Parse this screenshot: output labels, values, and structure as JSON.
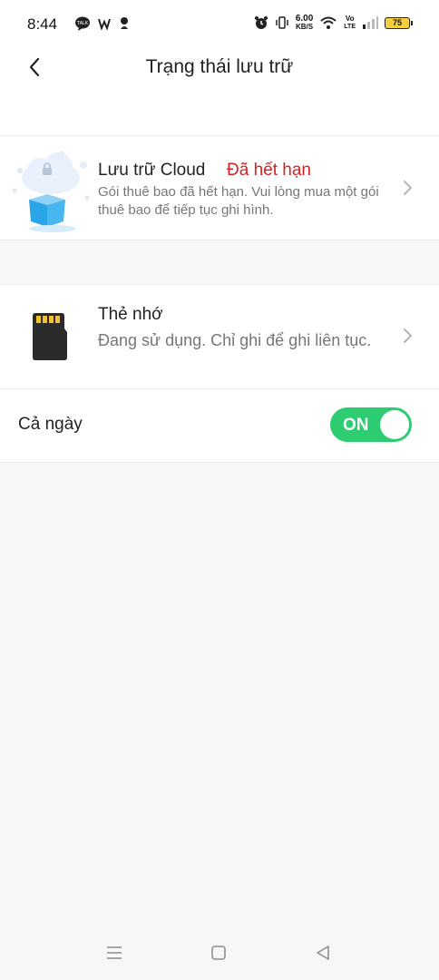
{
  "status_bar": {
    "time": "8:44",
    "app_icons": [
      "talk-icon",
      "w-icon",
      "pin-icon"
    ],
    "net_speed_value": "6.00",
    "net_speed_unit": "KB/S",
    "volte_top": "Vo",
    "volte_bottom": "LTE",
    "battery": "75"
  },
  "header": {
    "title": "Trạng thái lưu trữ",
    "back_icon": "chevron-left-icon"
  },
  "cloud_storage": {
    "title": "Lưu trữ Cloud",
    "badge": "Đã hết hạn",
    "description": "Gói thuê bao đã hết hạn. Vui lòng mua một gói thuê bao để tiếp tục ghi hình.",
    "icon": "cloud-storage-icon"
  },
  "memory_card": {
    "title": "Thẻ nhớ",
    "description": "Đang sử dụng. Chỉ ghi để ghi liên tục.",
    "icon": "sd-card-icon"
  },
  "all_day": {
    "label": "Cả ngày",
    "toggle_text": "ON",
    "toggle_on": true
  },
  "colors": {
    "badge_red": "#d42222",
    "toggle_green": "#2ecc71"
  },
  "nav_bar": {
    "icons": [
      "menu-icon",
      "home-square-icon",
      "back-triangle-icon"
    ]
  }
}
